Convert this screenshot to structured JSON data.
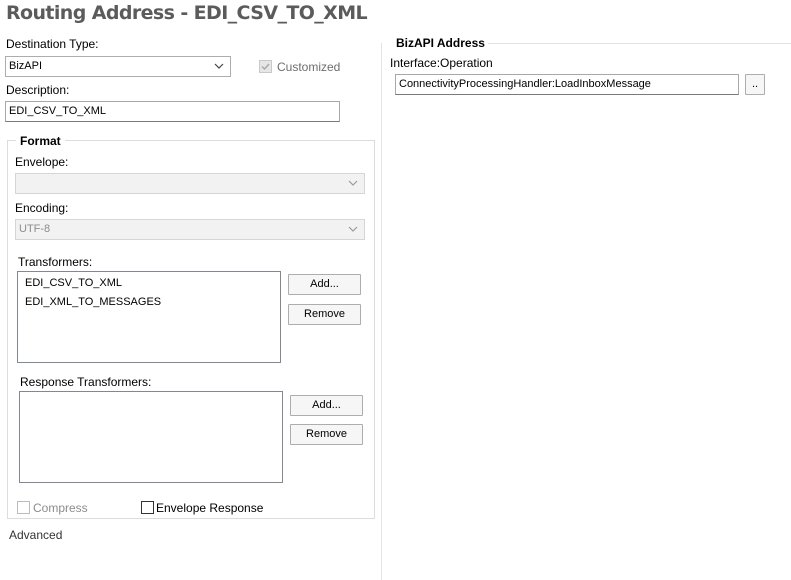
{
  "window": {
    "title": "Routing Address - EDI_CSV_TO_XML"
  },
  "left": {
    "destination_type": {
      "label": "Destination Type:",
      "value": "BizAPI"
    },
    "customized": {
      "label": "Customized",
      "checked": true,
      "enabled": false
    },
    "description": {
      "label": "Description:",
      "value": "EDI_CSV_TO_XML"
    },
    "format": {
      "legend": "Format",
      "envelope": {
        "label": "Envelope:",
        "value": ""
      },
      "encoding": {
        "label": "Encoding:",
        "value": "UTF-8"
      },
      "transformers": {
        "label": "Transformers:",
        "items": [
          "EDI_CSV_TO_XML",
          "EDI_XML_TO_MESSAGES"
        ],
        "add_label": "Add...",
        "remove_label": "Remove"
      },
      "response_transformers": {
        "label": "Response Transformers:",
        "items": [],
        "add_label": "Add...",
        "remove_label": "Remove"
      },
      "compress": {
        "label": "Compress",
        "checked": false,
        "enabled": false
      },
      "envelope_response": {
        "label": "Envelope Response",
        "checked": false,
        "enabled": true
      }
    },
    "advanced_label": "Advanced"
  },
  "right": {
    "section_title": "BizAPI Address",
    "interface_label": "Interface:Operation",
    "interface_value": "ConnectivityProcessingHandler:LoadInboxMessage",
    "browse_label": ".."
  }
}
